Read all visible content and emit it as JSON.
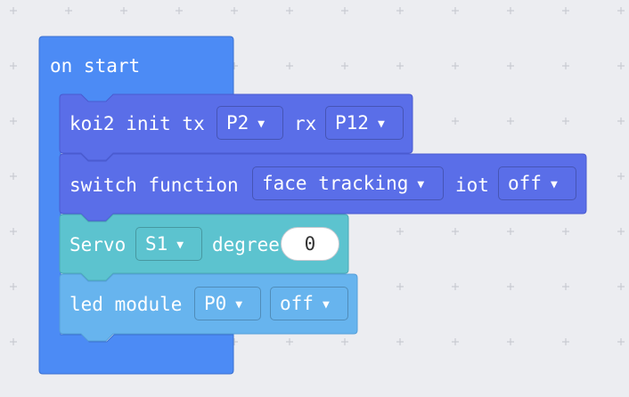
{
  "colors": {
    "background": "#ecedf1",
    "grid_cross": "#c9cbd2",
    "on_start": "#4c8bf5",
    "koi2": "#5a6ee8",
    "servo": "#5cc3cf",
    "led": "#67b4ee"
  },
  "on_start": {
    "label": "on start"
  },
  "koi2_init": {
    "label": "koi2 init tx",
    "tx_value": "P2",
    "rx_label": "rx",
    "rx_value": "P12"
  },
  "switch_function": {
    "label": "switch function",
    "function_value": "face tracking",
    "iot_label": "iot",
    "iot_value": "off"
  },
  "servo": {
    "label": "Servo",
    "servo_value": "S1",
    "degree_label": "degree",
    "degree_value": "0"
  },
  "led_module": {
    "label": "led module",
    "pin_value": "P0",
    "state_value": "off"
  },
  "icons": {
    "dropdown": "dropdown-arrow-icon"
  }
}
